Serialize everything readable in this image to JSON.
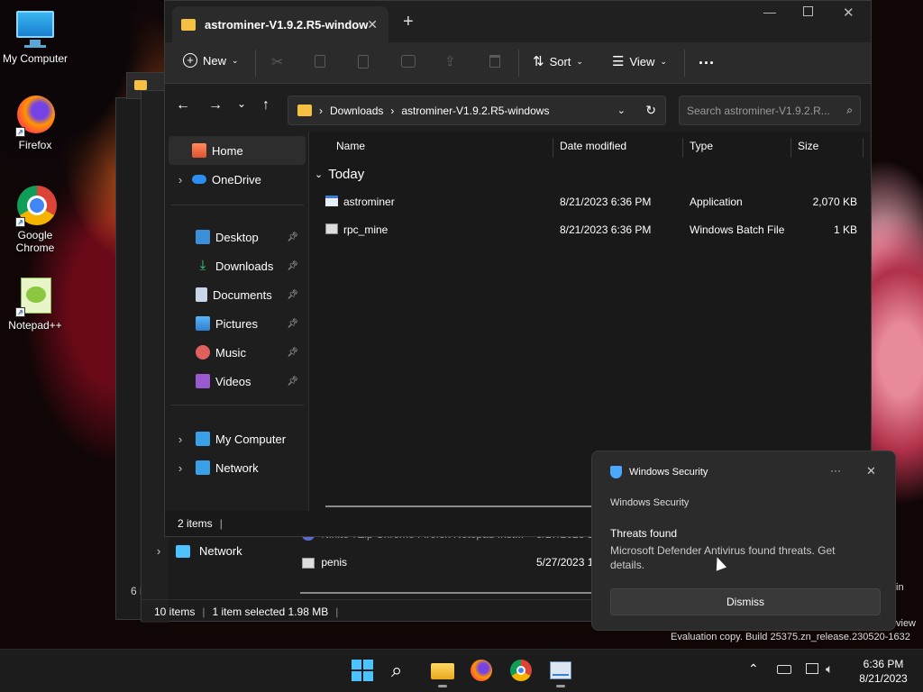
{
  "desktop": {
    "icons": [
      {
        "label": "My Computer",
        "icon": "computer-icon"
      },
      {
        "label": "Firefox",
        "icon": "firefox-icon"
      },
      {
        "label": "Google Chrome",
        "icon": "chrome-icon"
      },
      {
        "label": "Notepad++",
        "icon": "notepadpp-icon"
      }
    ],
    "watermark": {
      "line1": "Evaluation copy. Build 25375.zn_release.230520-1632",
      "partial_word": "view",
      "partial_in": "in"
    }
  },
  "explorer": {
    "tab_title": "astrominer-V1.9.2.R5-window",
    "toolbar": {
      "new": "New",
      "sort": "Sort",
      "view": "View",
      "more": "..."
    },
    "breadcrumb": [
      "Downloads",
      "astrominer-V1.9.2.R5-windows"
    ],
    "search_placeholder": "Search astrominer-V1.9.2.R...",
    "sidebar": {
      "home": "Home",
      "onedrive": "OneDrive",
      "pinned": [
        "Desktop",
        "Downloads",
        "Documents",
        "Pictures",
        "Music",
        "Videos"
      ],
      "my_computer": "My Computer",
      "network": "Network"
    },
    "columns": {
      "name": "Name",
      "date": "Date modified",
      "type": "Type",
      "size": "Size"
    },
    "group": "Today",
    "files": [
      {
        "name": "astrominer",
        "date": "8/21/2023 6:36 PM",
        "type": "Application",
        "size": "2,070 KB"
      },
      {
        "name": "rpc_mine",
        "date": "8/21/2023 6:36 PM",
        "type": "Windows Batch File",
        "size": "1 KB"
      }
    ],
    "status": "2 items"
  },
  "back_window": {
    "network": "Network",
    "rows": [
      {
        "name": "Ninite 7Zip Chrome Firefox Notepad Inst...",
        "date": "5/27/2023 1"
      },
      {
        "name": "penis",
        "date": "5/27/2023 1"
      }
    ],
    "status_items": "10 items",
    "status_selected": "1 item selected  1.98 MB",
    "left_count": "6 i"
  },
  "notification": {
    "app": "Windows Security",
    "subtitle": "Windows Security",
    "title": "Threats found",
    "body": "Microsoft Defender Antivirus found threats. Get details.",
    "more": "···",
    "dismiss": "Dismiss"
  },
  "taskbar": {
    "time": "6:36 PM",
    "date": "8/21/2023"
  },
  "colors": {
    "accent": "#4cc2ff",
    "folder": "#f5c142",
    "panel": "#191919",
    "notif": "#2b2b2b"
  }
}
